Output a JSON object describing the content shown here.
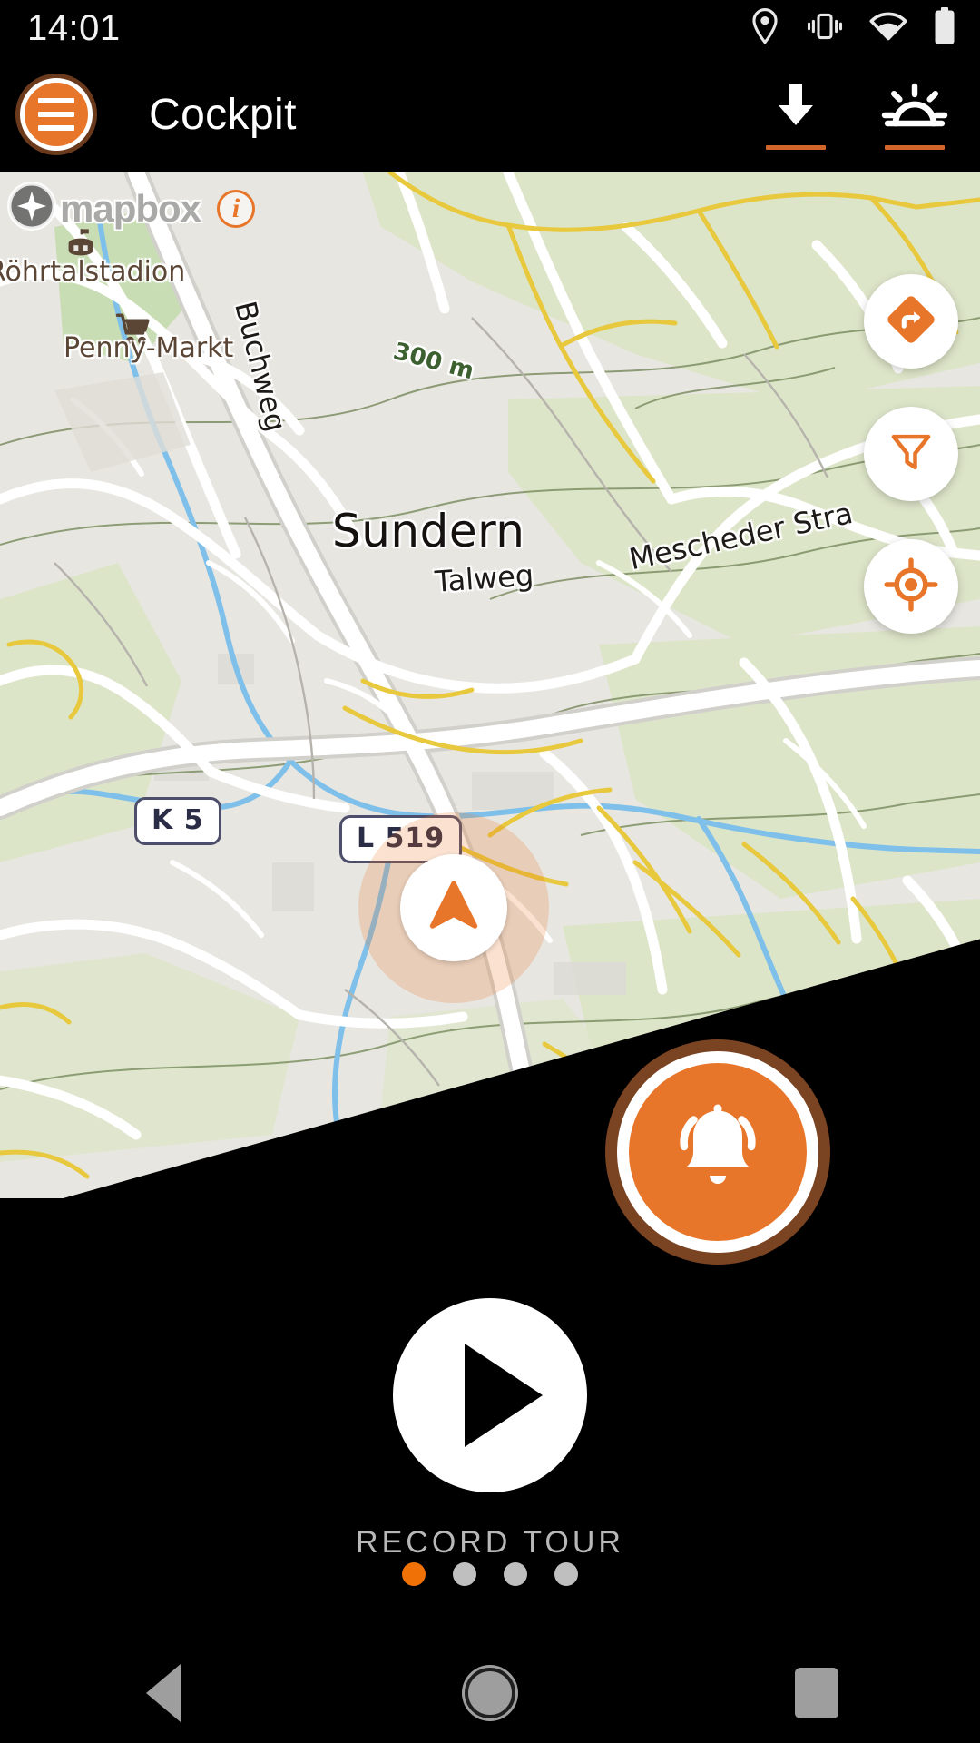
{
  "status_bar": {
    "time": "14:01",
    "icons": [
      {
        "name": "location-icon"
      },
      {
        "name": "vibrate-icon"
      },
      {
        "name": "wifi-icon"
      },
      {
        "name": "battery-icon"
      }
    ]
  },
  "app_bar": {
    "menu_button": "menu-icon",
    "title": "Cockpit",
    "actions": [
      {
        "name": "download-icon",
        "label": "Download"
      },
      {
        "name": "daynight-icon",
        "label": "Day/Night"
      }
    ],
    "accent_color": "#e8762a",
    "underline_color": "#d2662a"
  },
  "map": {
    "attribution": {
      "wordmark": "mapbox",
      "info_label": "i"
    },
    "labels": [
      {
        "text": "Röhrtalstadion",
        "type": "poi"
      },
      {
        "text": "Penny-Markt",
        "type": "poi"
      },
      {
        "text": "Buchweg",
        "type": "street"
      },
      {
        "text": "300 m",
        "type": "contour"
      },
      {
        "text": "Sundern",
        "type": "city"
      },
      {
        "text": "Talweg",
        "type": "street"
      },
      {
        "text": "Mescheder Stra",
        "type": "street"
      }
    ],
    "shields": [
      {
        "text": "K 5"
      },
      {
        "text": "L 519"
      }
    ],
    "controls": [
      {
        "name": "route-icon",
        "label": "Navigation"
      },
      {
        "name": "filter-icon",
        "label": "Filter"
      },
      {
        "name": "locate-icon",
        "label": "My location"
      }
    ],
    "position_marker": "navigation-arrow-icon",
    "accent_color": "#e8762a",
    "land_color": "#e6e4df",
    "green_color": "#d9e3c4",
    "water_color": "#6fb3e0",
    "road_color": "#ffffff",
    "track_color": "#e3c23a"
  },
  "alarm_fab": {
    "icon": "bell-icon",
    "label": "Alarm",
    "color": "#e8762a"
  },
  "record": {
    "icon": "play-icon",
    "label": "RECORD TOUR"
  },
  "page_dots": {
    "count": 4,
    "active_index": 0,
    "active_color": "#f07206",
    "inactive_color": "#bfbfbf"
  },
  "nav_bar": {
    "buttons": [
      {
        "name": "nav-back-icon",
        "label": "Back"
      },
      {
        "name": "nav-home-icon",
        "label": "Home"
      },
      {
        "name": "nav-recents-icon",
        "label": "Recents"
      }
    ]
  }
}
